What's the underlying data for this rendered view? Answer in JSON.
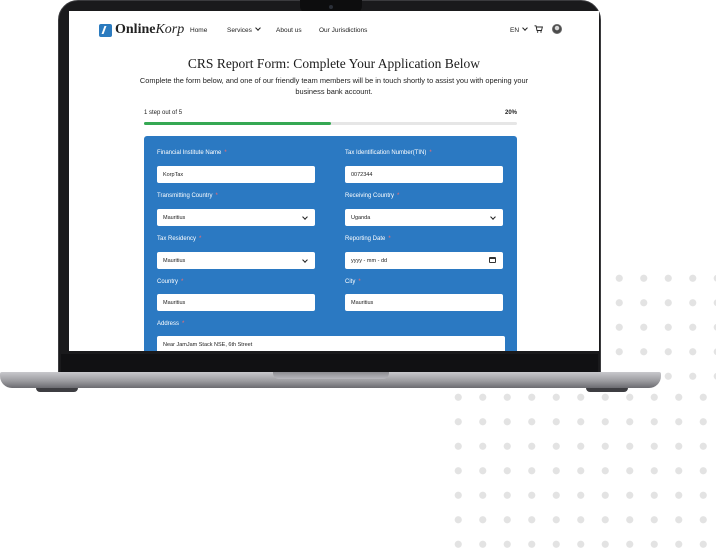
{
  "nav": {
    "logo_bold": "Online",
    "logo_italic": "Korp",
    "links": [
      "Home",
      "Services",
      "About us",
      "Our Jurisdictions"
    ],
    "language": "EN",
    "icons": [
      "cart-icon",
      "avatar-icon",
      "chevron-down-icon"
    ]
  },
  "header": {
    "title": "CRS Report Form: Complete Your Application Below",
    "subtitle": "Complete the form below, and one of our friendly team members will be in touch shortly to assist you with opening your business bank account."
  },
  "progress": {
    "label": "1 step out of 5",
    "percent_label": "20%",
    "fraction": 0.5,
    "color": "#35a853"
  },
  "form": {
    "background": "#2b79c2",
    "fields": {
      "financial_institute_name": {
        "label": "Financial Institute Name",
        "value": "KorpTax"
      },
      "tin": {
        "label": "Tax Identification Number(TIN)",
        "value": "0072344"
      },
      "transmitting_country": {
        "label": "Transmitting Country",
        "value": "Mauritius"
      },
      "receiving_country": {
        "label": "Receiving Country",
        "value": "Uganda"
      },
      "tax_residency": {
        "label": "Tax Residency",
        "value": "Mauritius"
      },
      "reporting_date": {
        "label": "Reporting Date",
        "placeholder": "yyyy - mm - dd"
      },
      "country": {
        "label": "Country",
        "value": "Mauritius"
      },
      "city": {
        "label": "City",
        "value": "Mauritius"
      },
      "address": {
        "label": "Address",
        "value": "Near JamJam Stack NSE, 6th Street"
      }
    },
    "required_mark": "*"
  }
}
